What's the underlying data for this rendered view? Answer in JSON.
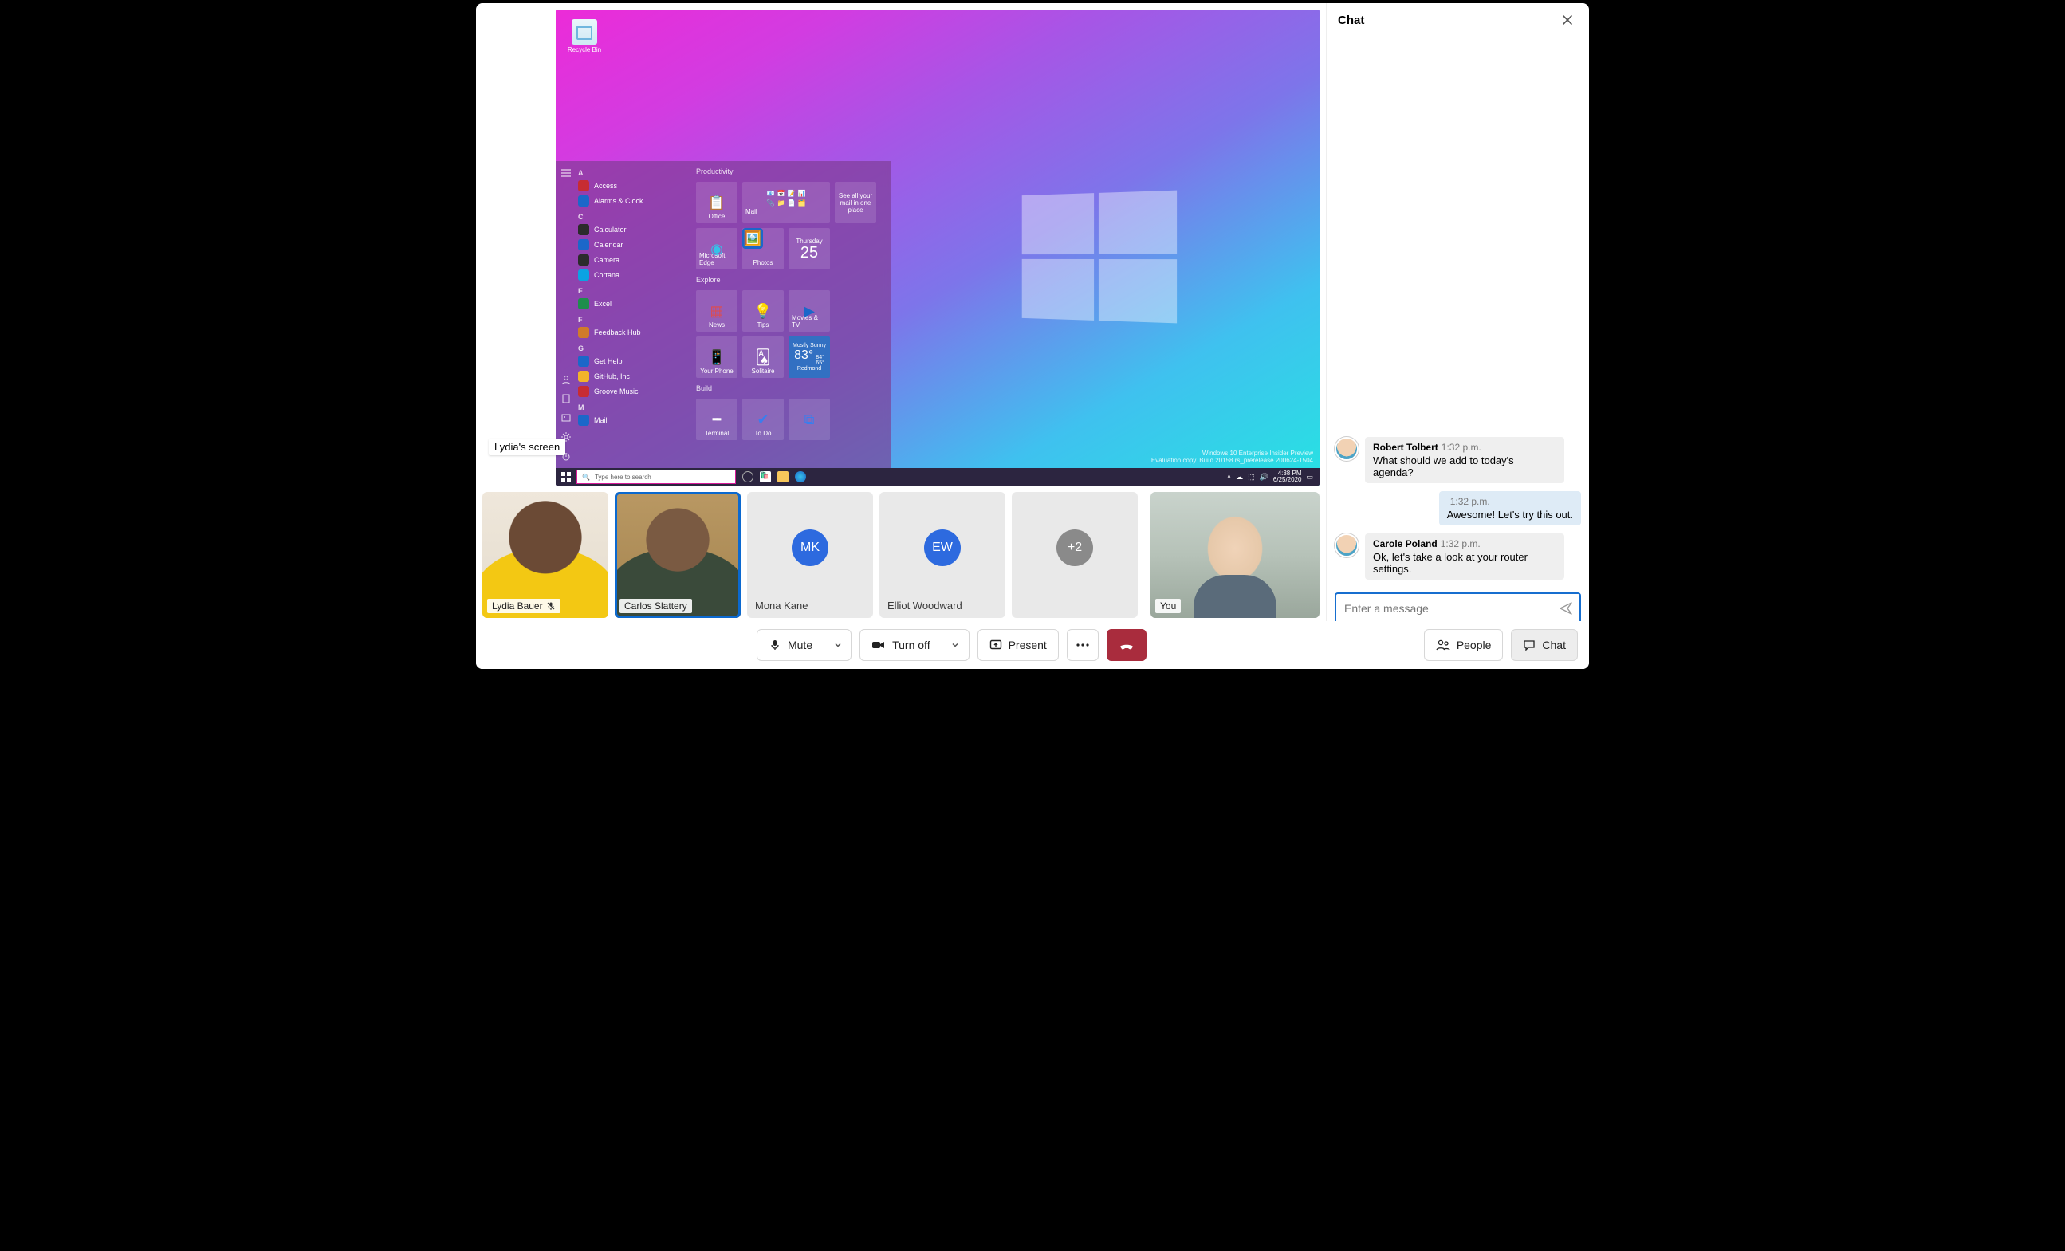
{
  "share": {
    "label": "Lydia's screen"
  },
  "desktop": {
    "recycle": "Recycle Bin",
    "apps_sections": [
      {
        "letter": "A",
        "items": [
          {
            "label": "Access",
            "color": "#c72c33"
          },
          {
            "label": "Alarms & Clock",
            "color": "#1b67c9"
          }
        ]
      },
      {
        "letter": "C",
        "items": [
          {
            "label": "Calculator",
            "color": "#2b2b2b"
          },
          {
            "label": "Calendar",
            "color": "#1b67c9"
          },
          {
            "label": "Camera",
            "color": "#2b2b2b"
          },
          {
            "label": "Cortana",
            "color": "#0aa3e3"
          }
        ]
      },
      {
        "letter": "E",
        "items": [
          {
            "label": "Excel",
            "color": "#1e8e4c"
          }
        ]
      },
      {
        "letter": "F",
        "items": [
          {
            "label": "Feedback Hub",
            "color": "#d07b2b"
          }
        ]
      },
      {
        "letter": "G",
        "items": [
          {
            "label": "Get Help",
            "color": "#1b67c9"
          },
          {
            "label": "GitHub, Inc",
            "color": "#f2b32a"
          },
          {
            "label": "Groove Music",
            "color": "#c72c33"
          }
        ]
      },
      {
        "letter": "M",
        "items": [
          {
            "label": "Mail",
            "color": "#1b67c9"
          }
        ]
      }
    ],
    "tiles": {
      "productivity": "Productivity",
      "office": "Office",
      "mail_tile": "Mail",
      "mail_desc": "See all your mail in one place",
      "edge": "Microsoft Edge",
      "photos": "Photos",
      "day_label": "Thursday",
      "day_num": "25",
      "explore": "Explore",
      "news": "News",
      "tips": "Tips",
      "movies": "Movies & TV",
      "yourphone": "Your Phone",
      "solitaire": "Solitaire",
      "weather_cond": "Mostly Sunny",
      "weather_temp": "83°",
      "weather_hi": "84°",
      "weather_lo": "65°",
      "weather_city": "Redmond",
      "build": "Build",
      "terminal": "Terminal",
      "todo": "To Do"
    },
    "search_placeholder": "Type here to search",
    "watermark": {
      "l1": "Windows 10 Enterprise Insider Preview",
      "l2": "Evaluation copy. Build 20158.rs_prerelease.200624-1504"
    },
    "clock": {
      "time": "4:38 PM",
      "date": "6/25/2020"
    }
  },
  "participants": [
    {
      "name": "Lydia Bauer",
      "muted": true,
      "kind": "video1"
    },
    {
      "name": "Carlos Slattery",
      "speaking": true,
      "kind": "video2"
    },
    {
      "name": "Mona Kane",
      "initials": "MK",
      "color": "#2d6adf",
      "kind": "initials"
    },
    {
      "name": "Elliot Woodward",
      "initials": "EW",
      "color": "#2d6adf",
      "kind": "initials"
    },
    {
      "overflow": "+2",
      "color": "#8a8a8a",
      "kind": "overflow"
    }
  ],
  "self_label": "You",
  "controls": {
    "mute": "Mute",
    "camera": "Turn off",
    "present": "Present",
    "people": "People",
    "chat": "Chat"
  },
  "chat": {
    "title": "Chat",
    "messages": [
      {
        "from": "Robert Tolbert",
        "time": "1:32 p.m.",
        "text": "What should we add to today's agenda?",
        "self": false
      },
      {
        "time": "1:32 p.m.",
        "text": "Awesome! Let's try this out.",
        "self": true
      },
      {
        "from": "Carole Poland",
        "time": "1:32 p.m.",
        "text": "Ok, let's take a look at your router settings.",
        "self": false
      }
    ],
    "placeholder": "Enter a message"
  }
}
